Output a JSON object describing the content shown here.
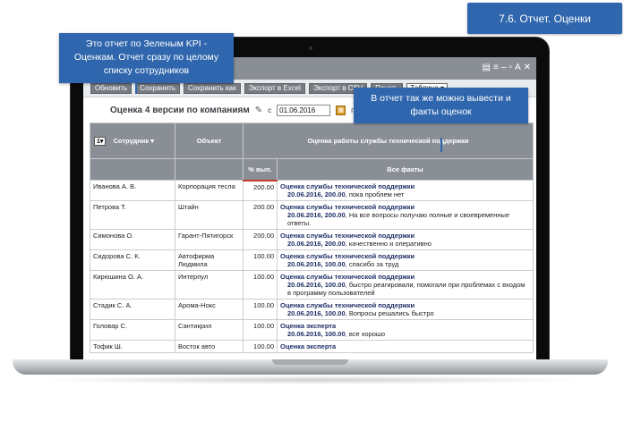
{
  "slide_badge": "7.6. Отчет. Оценки",
  "callouts": {
    "left": "Это отчет по Зеленым KPI - Оценкам. Отчет сразу по целому списку сотрудников",
    "right": "В отчет так же можно вывести и факты оценок"
  },
  "window": {
    "controls": [
      "▤",
      "≡",
      "–",
      "▫",
      "A",
      "✕"
    ]
  },
  "toolbar": {
    "buttons": [
      "Обновить",
      "Сохранить",
      "Сохранить как",
      "Экспорт в Excel",
      "Экспорт в CSV",
      "Печать"
    ],
    "select_value": "Таблица"
  },
  "report": {
    "title": "Оценка 4 версии по компаниям",
    "date_prefix": "с",
    "date_value": "01.06.2016",
    "calendar_icon": "calendar-icon",
    "trailing_text": "п"
  },
  "table": {
    "sort_value": "1",
    "col_employee": "Сотрудник",
    "col_object": "Объект",
    "col_group": "Оценка работы службы технической поддержки",
    "col_pct": "% вып.",
    "col_facts": "Все факты",
    "rows": [
      {
        "employee": "Иванова А. В.",
        "object": "Корпорация тесла",
        "pct": "200.00",
        "fact_title": "Оценка службы технической поддержки",
        "fact_date_value": "20.06.2016, 200.00",
        "fact_text": ", пока проблем нет"
      },
      {
        "employee": "Петрова Т.",
        "object": "Штайн",
        "pct": "200.00",
        "fact_title": "Оценка службы технической поддержки",
        "fact_date_value": "20.06.2016, 200.00",
        "fact_text": ", На все вопросы получаю полные и своевременные ответы."
      },
      {
        "employee": "Симонова О.",
        "object": "Гарант-Пятигорск",
        "pct": "200.00",
        "fact_title": "Оценка службы технической поддержки",
        "fact_date_value": "20.06.2016, 200.00",
        "fact_text": ", качественно и оперативно"
      },
      {
        "employee": "Сидорова С. К.",
        "object": "Автофирма Людмила",
        "pct": "100.00",
        "fact_title": "Оценка службы технической поддержки",
        "fact_date_value": "20.06.2016, 100.00",
        "fact_text": ", спасибо за труд"
      },
      {
        "employee": "Кирюшина О. А.",
        "object": "Интерпул",
        "pct": "100.00",
        "fact_title": "Оценка службы технической поддержки",
        "fact_date_value": "20.06.2016, 100.00",
        "fact_text": ", быстро реагировали, помогали при проблемах с входом в программу пользователей"
      },
      {
        "employee": "Стадик С. А.",
        "object": "Арома-Нокс",
        "pct": "100.00",
        "fact_title": "Оценка службы технической поддержки",
        "fact_date_value": "20.06.2016, 100.00",
        "fact_text": ", Вопросы решались быстро"
      },
      {
        "employee": "Головар С.",
        "object": "Сантикрил",
        "pct": "100.00",
        "fact_title": "Оценка эксперта",
        "fact_date_value": "20.06.2016, 100.00",
        "fact_text": ", все хорошо"
      },
      {
        "employee": "Тофик Ш.",
        "object": "Восток авто",
        "pct": "100.00",
        "fact_title": "Оценка эксперта",
        "fact_date_value": "",
        "fact_text": ""
      }
    ]
  },
  "colors": {
    "accent_blue": "#2f66ad",
    "header_gray": "#8a8f96",
    "fact_title": "#1f2f66"
  }
}
